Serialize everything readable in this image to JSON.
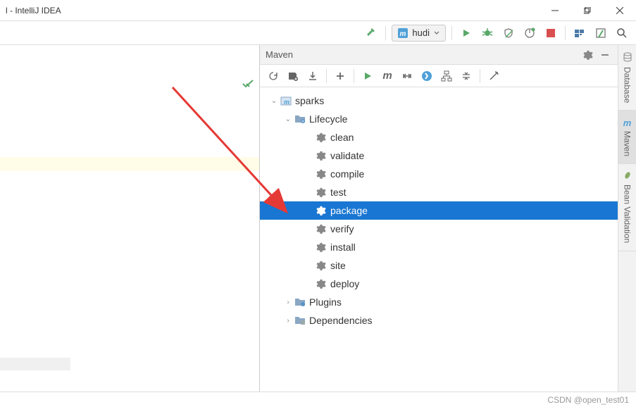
{
  "titlebar": {
    "title": "l - IntelliJ IDEA"
  },
  "toolbar": {
    "run_config": "hudi"
  },
  "maven": {
    "title": "Maven",
    "root": "sparks",
    "lifecycle_label": "Lifecycle",
    "lifecycle": [
      "clean",
      "validate",
      "compile",
      "test",
      "package",
      "verify",
      "install",
      "site",
      "deploy"
    ],
    "selected": "package",
    "plugins_label": "Plugins",
    "dependencies_label": "Dependencies"
  },
  "sidebar": {
    "tabs": [
      {
        "label": "Database"
      },
      {
        "label": "Maven"
      },
      {
        "label": "Bean Validation"
      }
    ]
  },
  "status": {
    "watermark": "CSDN @open_test01"
  }
}
